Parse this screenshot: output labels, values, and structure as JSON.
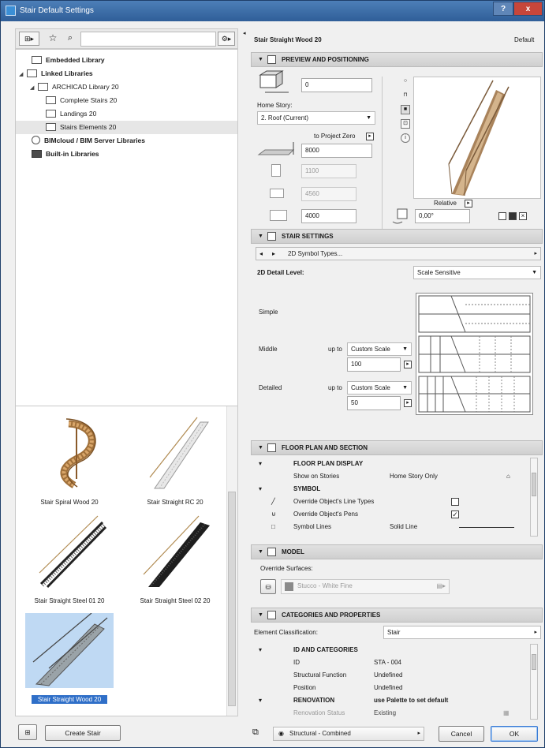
{
  "window": {
    "title": "Stair Default Settings",
    "help": "?",
    "close": "x"
  },
  "left": {
    "tree": [
      {
        "label": "Embedded Library",
        "bold": true
      },
      {
        "label": "Linked Libraries",
        "bold": true
      },
      {
        "label": "ARCHICAD Library 20",
        "bold": false
      },
      {
        "label": "Complete Stairs 20",
        "bold": false
      },
      {
        "label": "Landings 20",
        "bold": false
      },
      {
        "label": "Stairs Elements 20",
        "bold": false
      },
      {
        "label": "BIMcloud / BIM Server Libraries",
        "bold": true
      },
      {
        "label": "Built-in Libraries",
        "bold": true
      }
    ],
    "gallery": [
      {
        "label": "Stair Spiral Wood 20"
      },
      {
        "label": "Stair Straight RC 20"
      },
      {
        "label": "Stair Straight Steel 01 20"
      },
      {
        "label": "Stair Straight Steel 02 20"
      },
      {
        "label": "Stair Straight Wood 20"
      }
    ],
    "create_button": "Create Stair"
  },
  "right": {
    "header": {
      "name": "Stair Straight Wood 20",
      "default": "Default"
    },
    "preview": {
      "section": "PREVIEW AND POSITIONING",
      "offset": "0",
      "home_story_label": "Home Story:",
      "home_story": "2. Roof (Current)",
      "to_project_zero": "to Project Zero",
      "project_zero_value": "8000",
      "width": "1100",
      "length": "4560",
      "height": "4000",
      "relative": "Relative",
      "angle": "0,00°"
    },
    "stair_settings": {
      "section": "STAIR SETTINGS",
      "nav_label": "2D Symbol Types...",
      "detail_label": "2D Detail Level:",
      "detail_value": "Scale Sensitive",
      "simple": "Simple",
      "middle": "Middle",
      "detailed": "Detailed",
      "up_to": "up to",
      "middle_scale": "Custom Scale",
      "middle_value": "100",
      "detailed_scale": "Custom Scale",
      "detailed_value": "50"
    },
    "floor_plan": {
      "section": "FLOOR PLAN AND SECTION",
      "rows": [
        {
          "name": "FLOOR PLAN DISPLAY",
          "value": "",
          "head": true
        },
        {
          "name": "Show on Stories",
          "value": "Home Story Only",
          "head": false
        },
        {
          "name": "SYMBOL",
          "value": "",
          "head": true
        },
        {
          "name": "Override Object's Line Types",
          "value": "",
          "head": false
        },
        {
          "name": "Override Object's Pens",
          "value": "",
          "head": false
        },
        {
          "name": "Symbol Lines",
          "value": "Solid Line",
          "head": false
        }
      ]
    },
    "model": {
      "section": "MODEL",
      "override_label": "Override Surfaces:",
      "surface": "Stucco - White Fine"
    },
    "categories": {
      "section": "CATEGORIES AND PROPERTIES",
      "classification_label": "Element Classification:",
      "classification": "Stair",
      "rows": [
        {
          "name": "ID AND CATEGORIES",
          "value": "",
          "head": true
        },
        {
          "name": "ID",
          "value": "STA - 004",
          "head": false
        },
        {
          "name": "Structural Function",
          "value": "Undefined",
          "head": false
        },
        {
          "name": "Position",
          "value": "Undefined",
          "head": false
        },
        {
          "name": "RENOVATION",
          "value": "use Palette to set default",
          "head": true
        },
        {
          "name": "Renovation Status",
          "value": "Existing",
          "head": false
        }
      ]
    },
    "footer": {
      "layer": "Structural - Combined",
      "cancel": "Cancel",
      "ok": "OK"
    }
  }
}
